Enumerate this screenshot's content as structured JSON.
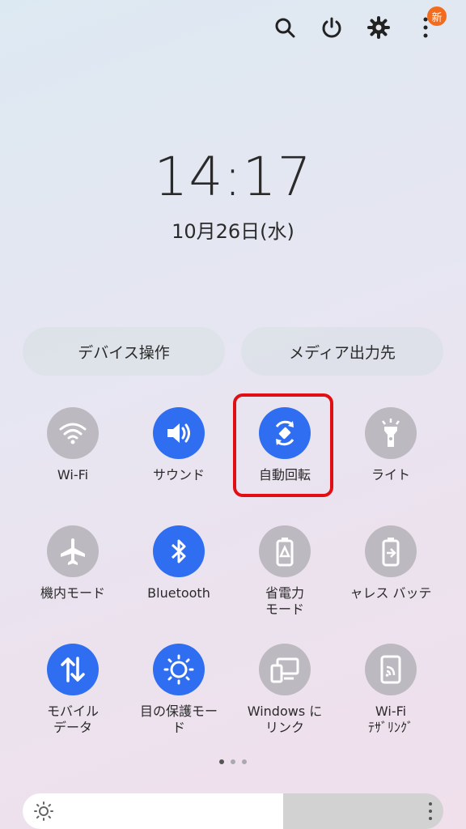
{
  "topbar": {
    "icons": [
      "search-icon",
      "power-icon",
      "gear-icon",
      "more-vertical-icon"
    ],
    "badge": "新"
  },
  "lockscreen": {
    "time": "14:17",
    "date": "10月26日(水)"
  },
  "pills": {
    "device_control": "デバイス操作",
    "media_output": "メディア出力先"
  },
  "tiles": [
    {
      "label": "Wi-Fi",
      "icon": "wifi-icon",
      "state": "off"
    },
    {
      "label": "サウンド",
      "icon": "volume-icon",
      "state": "on"
    },
    {
      "label": "自動回転",
      "icon": "auto-rotate-icon",
      "state": "on"
    },
    {
      "label": "ライト",
      "icon": "flashlight-icon",
      "state": "off"
    },
    {
      "label": "機内モード",
      "icon": "airplane-icon",
      "state": "off"
    },
    {
      "label": "Bluetooth",
      "icon": "bluetooth-icon",
      "state": "on"
    },
    {
      "label1": "省電力",
      "label2": "モード",
      "icon": "power-saving-icon",
      "state": "off"
    },
    {
      "label": "ャレス バッテ",
      "icon": "wireless-battery-share-icon",
      "state": "off"
    },
    {
      "label1": "モバイル",
      "label2": "データ",
      "icon": "mobile-data-icon",
      "state": "on"
    },
    {
      "label1": "目の保護モー",
      "label2": "ド",
      "icon": "eye-comfort-icon",
      "state": "on"
    },
    {
      "label1": "Windows に",
      "label2": "リンク",
      "icon": "link-to-windows-icon",
      "state": "off"
    },
    {
      "label1": "Wi-Fi",
      "label2": "ﾃｻﾞﾘﾝｸﾞ",
      "icon": "wifi-tethering-icon",
      "state": "off"
    }
  ],
  "pagination": {
    "pages": 3,
    "current": 1
  },
  "brightness": {
    "level": 0.62
  },
  "colors": {
    "accent": "#2f6ef0",
    "inactive": "#bdb9c0",
    "highlight": "#e10f14",
    "badge": "#f36b1c"
  }
}
